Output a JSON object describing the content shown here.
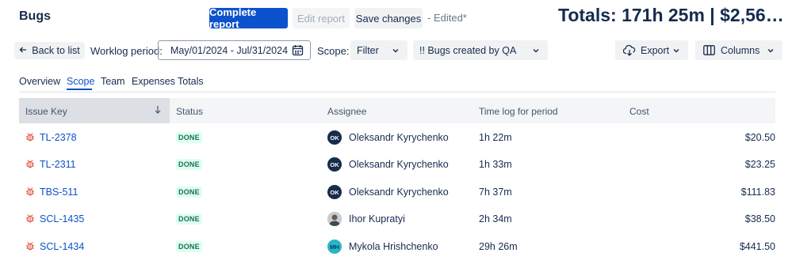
{
  "header": {
    "title": "Bugs",
    "complete_label": "Complete report",
    "edit_label": "Edit report",
    "save_label": "Save changes",
    "edited_text": "- Edited*",
    "totals": "Totals: 171h 25m | $2,56…"
  },
  "toolbar": {
    "back_label": "Back to list",
    "worklog_label": "Worklog period:",
    "date_range": "May/01/2024 - Jul/31/2024",
    "scope_label": "Scope:",
    "scope_filter": "Filter",
    "filter_value": "!! Bugs created by QA",
    "export_label": "Export",
    "columns_label": "Columns"
  },
  "tabs": [
    {
      "label": "Overview"
    },
    {
      "label": "Scope"
    },
    {
      "label": "Team"
    },
    {
      "label": "Expenses"
    },
    {
      "label": "Totals"
    }
  ],
  "active_tab": "Scope",
  "table": {
    "columns": [
      "Issue Key",
      "Status",
      "Assignee",
      "Time log for period",
      "Cost"
    ],
    "rows": [
      {
        "key": "TL-2378",
        "status": "DONE",
        "initials": "OK",
        "assignee": "Oleksandr Kyrychenko",
        "time": "1h 22m",
        "cost": "$20.50"
      },
      {
        "key": "TL-2311",
        "status": "DONE",
        "initials": "OK",
        "assignee": "Oleksandr Kyrychenko",
        "time": "1h 33m",
        "cost": "$23.25"
      },
      {
        "key": "TBS-511",
        "status": "DONE",
        "initials": "OK",
        "assignee": "Oleksandr Kyrychenko",
        "time": "7h 37m",
        "cost": "$111.83"
      },
      {
        "key": "SCL-1435",
        "status": "DONE",
        "initials": "",
        "assignee": "Ihor Kupratyi",
        "time": "2h 34m",
        "cost": "$38.50"
      },
      {
        "key": "SCL-1434",
        "status": "DONE",
        "initials": "MH",
        "assignee": "Mykola Hrishchenko",
        "time": "29h 26m",
        "cost": "$441.50"
      }
    ]
  },
  "colors": {
    "primary": "#0c52cc",
    "done_bg": "#dcfff1",
    "done_text": "#216e4e",
    "bug_icon": "#e34935"
  }
}
